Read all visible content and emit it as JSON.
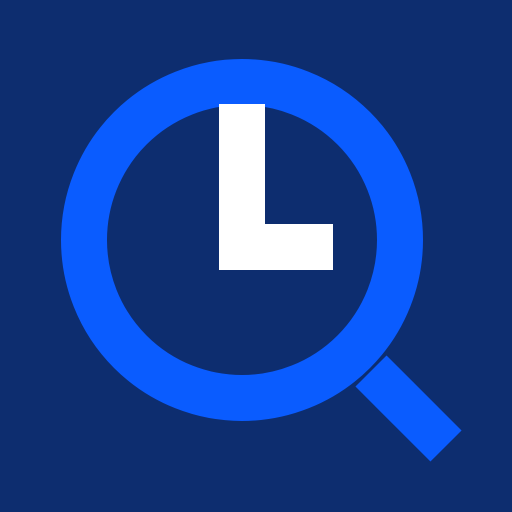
{
  "icon": {
    "name": "magnifier-clock-icon",
    "colors": {
      "background": "#0d2d6f",
      "ring": "#0a5cff",
      "clock_hands": "#ffffff"
    }
  }
}
